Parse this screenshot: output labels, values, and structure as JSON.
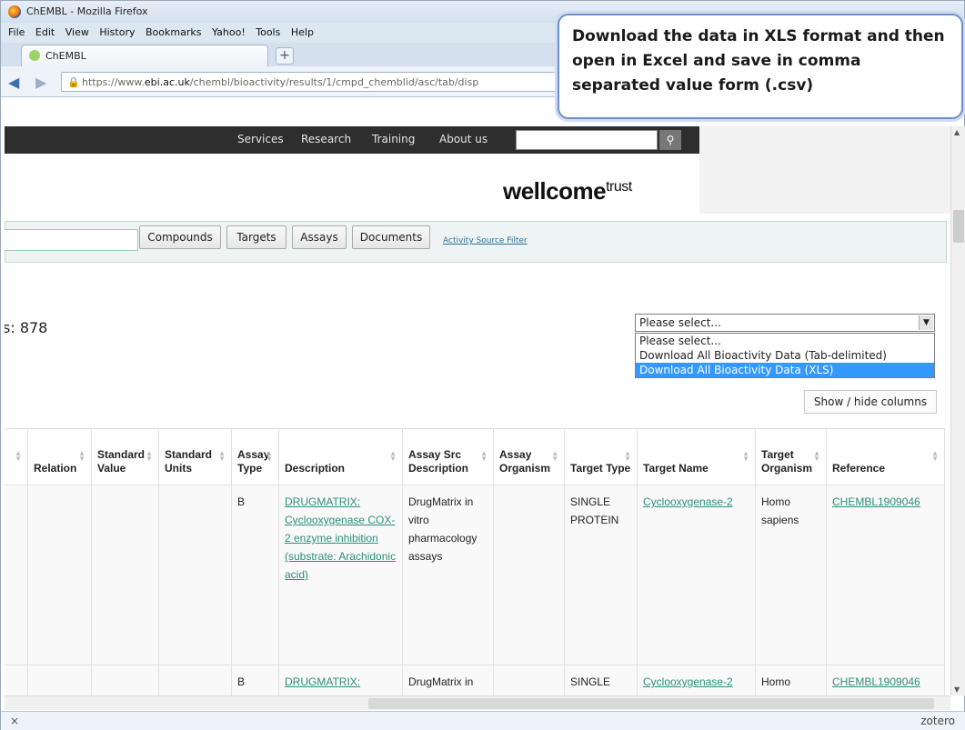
{
  "browser": {
    "window_title": "ChEMBL - Mozilla Firefox",
    "menu": [
      "File",
      "Edit",
      "View",
      "History",
      "Bookmarks",
      "Yahoo!",
      "Tools",
      "Help"
    ],
    "tab_label": "ChEMBL",
    "new_tab": "+",
    "url_prefix": "https://www.",
    "url_domain": "ebi.ac.uk",
    "url_path": "/chembl/bioactivity/results/1/cmpd_chemblid/asc/tab/disp"
  },
  "callout": {
    "text": "Download the data in XLS format and then open in Excel and save in comma separated value form (.csv)"
  },
  "site_nav": {
    "links": [
      "Services",
      "Research",
      "Training",
      "About us"
    ]
  },
  "logo": {
    "bold": "wellcome",
    "light": "trust"
  },
  "search_tabs": [
    "Compounds",
    "Targets",
    "Assays",
    "Documents"
  ],
  "activity_filter": "Activity Source Filter",
  "results_count": "s: 878",
  "download": {
    "selected": "Please select...",
    "options": [
      "Please select...",
      "Download All Bioactivity Data (Tab-delimited)",
      "Download All Bioactivity Data (XLS)"
    ],
    "highlighted_index": 2
  },
  "show_hide": "Show / hide columns",
  "table": {
    "headers": [
      "Relation",
      "Standard Value",
      "Standard Units",
      "Assay Type",
      "Description",
      "Assay Src Description",
      "Assay Organism",
      "Target Type",
      "Target Name",
      "Target Organism",
      "Reference"
    ],
    "rows": [
      {
        "relation": "",
        "std_value": "",
        "std_units": "",
        "assay_type": "B",
        "description": "DRUGMATRIX: Cyclooxygenase COX-2 enzyme inhibition (substrate: Arachidonic acid)",
        "src_desc": "DrugMatrix in vitro pharmacology assays",
        "assay_org": "",
        "target_type": "SINGLE PROTEIN",
        "target_name": "Cyclooxygenase-2",
        "target_org": "Homo sapiens",
        "reference": "CHEMBL1909046"
      },
      {
        "relation": "",
        "std_value": "",
        "std_units": "",
        "assay_type": "B",
        "description": "DRUGMATRIX:",
        "src_desc": "DrugMatrix in",
        "assay_org": "",
        "target_type": "SINGLE",
        "target_name": "Cyclooxygenase-2",
        "target_org": "Homo",
        "reference": "CHEMBL1909046"
      }
    ]
  },
  "status": {
    "close": "×",
    "addon": "zotero"
  }
}
